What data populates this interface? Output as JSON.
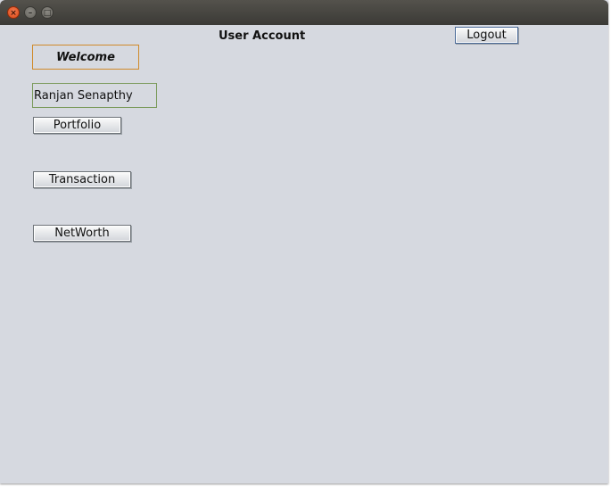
{
  "window": {
    "controls": {
      "close_glyph": "×",
      "minimize_glyph": "–",
      "maximize_glyph": "□"
    }
  },
  "page": {
    "heading": "User Account",
    "welcome": "Welcome",
    "user_name": "Ranjan Senapthy"
  },
  "buttons": {
    "logout": "Logout",
    "portfolio": "Portfolio",
    "transaction": "Transaction",
    "networth": "NetWorth"
  },
  "colors": {
    "window_bg": "#d6d9e0",
    "titlebar": "#3b3a36",
    "close_button": "#dd4814",
    "welcome_border": "#d08a2a",
    "name_field_border": "#7a9a5a"
  }
}
